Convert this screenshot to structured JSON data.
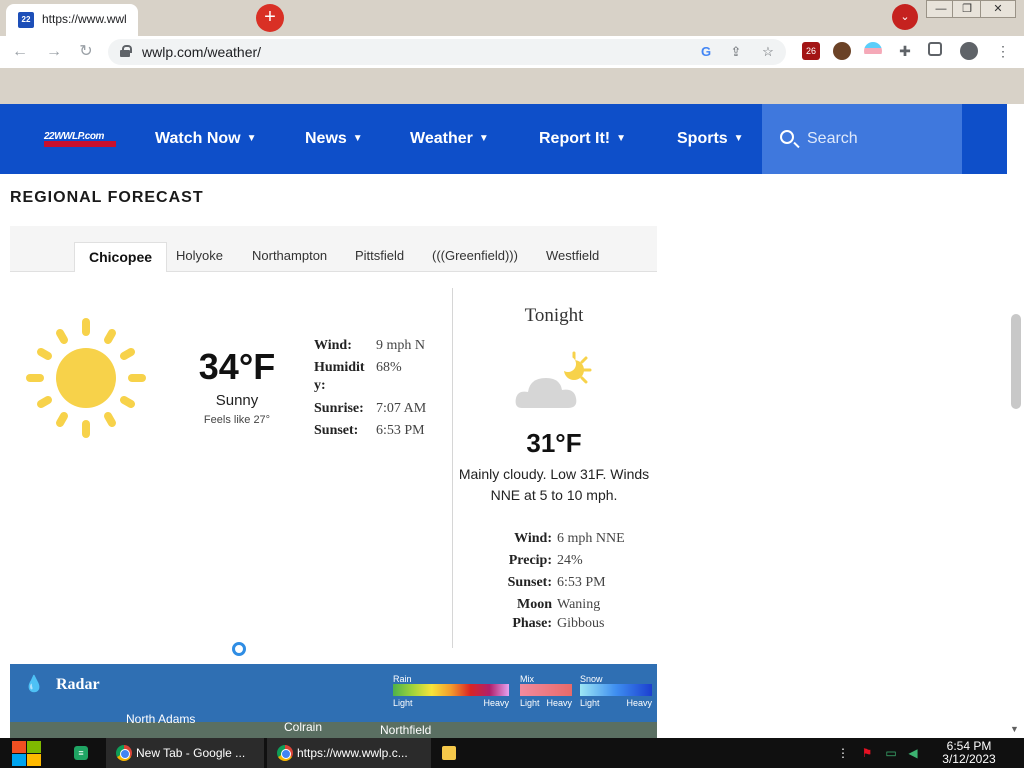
{
  "browser": {
    "tab_title": "https://www.wwl",
    "url": "wwlp.com/weather/",
    "extension_badge": "26",
    "window_controls": {
      "minimize": "—",
      "restore": "❐",
      "close": "✕"
    }
  },
  "site": {
    "logo_text": "22WWLP.com",
    "nav": [
      {
        "label": "Watch Now"
      },
      {
        "label": "News"
      },
      {
        "label": "Weather"
      },
      {
        "label": "Report It!"
      },
      {
        "label": "Sports"
      }
    ],
    "search_placeholder": "Search"
  },
  "forecast": {
    "section_title": "REGIONAL FORECAST",
    "cities": [
      "Chicopee",
      "Holyoke",
      "Northampton",
      "Pittsfield",
      "(((Greenfield)))",
      "Westfield"
    ],
    "active_city": "Chicopee",
    "current": {
      "icon": "sun-icon",
      "temp": "34°F",
      "condition": "Sunny",
      "feels_like": "Feels like 27°",
      "details": [
        {
          "label": "Wind:",
          "value": "9 mph N"
        },
        {
          "label": "Humidit",
          "label2": "y:",
          "value": "68%"
        },
        {
          "label": "Sunrise:",
          "value": "7:07 AM"
        },
        {
          "label": "Sunset:",
          "value": "6:53 PM"
        }
      ]
    },
    "tonight": {
      "title": "Tonight",
      "icon": "partly-cloudy-night-icon",
      "temp": "31°F",
      "description": "Mainly cloudy. Low 31F. Winds NNE at 5 to 10 mph.",
      "details": [
        {
          "label": "Wind:",
          "value": "6 mph NNE"
        },
        {
          "label": "Precip:",
          "value": "24%"
        },
        {
          "label": "Sunset:",
          "value": "6:53 PM"
        },
        {
          "label": "Moon",
          "label2": "Phase:",
          "value": "Waning",
          "value2": "Gibbous"
        }
      ]
    }
  },
  "radar": {
    "title": "Radar",
    "legend": [
      {
        "name": "Rain",
        "low": "Light",
        "high": "Heavy"
      },
      {
        "name": "Mix",
        "low": "Light",
        "high": "Heavy"
      },
      {
        "name": "Snow",
        "low": "Light",
        "high": "Heavy"
      }
    ],
    "towns": [
      "North Adams",
      "Colrain",
      "Northfield"
    ]
  },
  "taskbar": {
    "apps": [
      {
        "label": "New Tab - Google ..."
      },
      {
        "label": "https://www.wwlp.c..."
      }
    ],
    "time": "6:54 PM",
    "date": "3/12/2023"
  },
  "colors": {
    "nav_blue": "#0e4fc9",
    "search_blue": "#3f78dd",
    "sun_yellow": "#f7d24a"
  }
}
